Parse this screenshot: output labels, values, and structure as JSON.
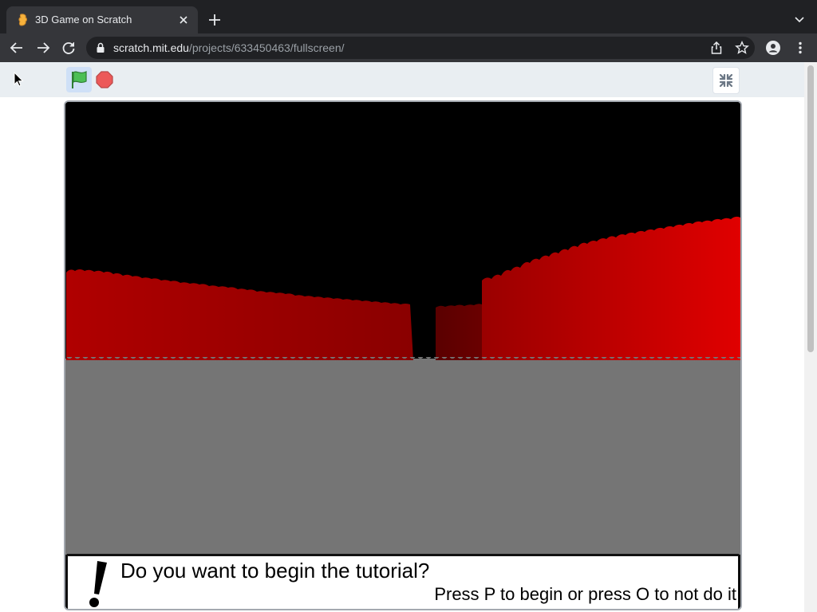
{
  "browser": {
    "tab_title": "3D Game on Scratch",
    "url_host": "scratch.mit.edu",
    "url_path": "/projects/633450463/fullscreen/"
  },
  "player": {
    "controls": [
      "green-flag",
      "stop-sign",
      "exit-fullscreen"
    ]
  },
  "game": {
    "colors": {
      "sky": "#000000",
      "floor": "#757575",
      "wall": "#e00000",
      "wall_dark": "#5a0000"
    },
    "dialog": {
      "question": "Do you want to begin the tutorial?",
      "hint": "Press P to begin or press O to not do it"
    }
  }
}
